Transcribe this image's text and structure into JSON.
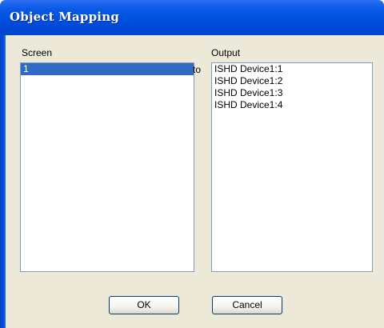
{
  "window": {
    "title": "Object Mapping"
  },
  "screen_list": {
    "label": "Screen",
    "items": [
      {
        "text": "1",
        "selected": true
      }
    ]
  },
  "connector": {
    "text": "to"
  },
  "output_list": {
    "label": "Output",
    "items": [
      {
        "text": "ISHD Device1:1"
      },
      {
        "text": "ISHD Device1:2"
      },
      {
        "text": "ISHD Device1:3"
      },
      {
        "text": "ISHD Device1:4"
      }
    ]
  },
  "buttons": {
    "ok_label": "OK",
    "cancel_label": "Cancel"
  }
}
